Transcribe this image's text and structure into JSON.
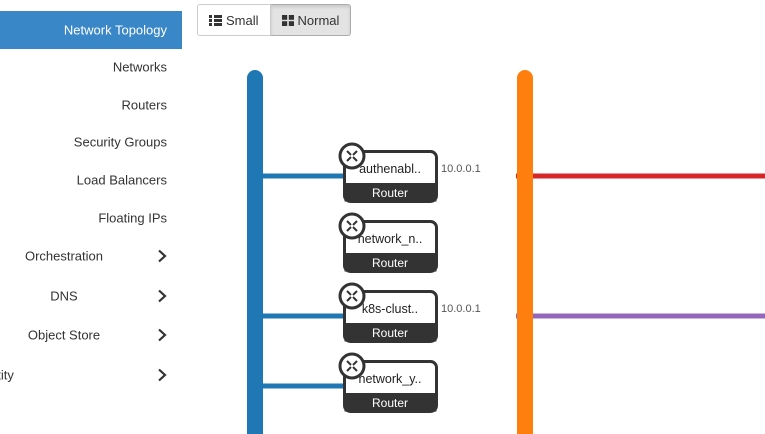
{
  "sidebar": {
    "items": [
      {
        "label": "Network Topology",
        "active": true
      },
      {
        "label": "Networks"
      },
      {
        "label": "Routers"
      },
      {
        "label": "Security Groups"
      },
      {
        "label": "Load Balancers"
      },
      {
        "label": "Floating IPs"
      }
    ],
    "groups": [
      {
        "label": "Orchestration",
        "icon": "chevron-right-icon"
      },
      {
        "label": "DNS",
        "icon": "chevron-right-icon"
      },
      {
        "label": "Object Store",
        "icon": "chevron-right-icon"
      },
      {
        "label": "ntity",
        "icon": "chevron-right-icon"
      }
    ]
  },
  "toolbar": {
    "small_label": "Small",
    "normal_label": "Normal",
    "active": "Normal"
  },
  "topology": {
    "routers": [
      {
        "name": "authenabl..",
        "type": "Router",
        "cidr": "10.0.0.1"
      },
      {
        "name": "network_n..",
        "type": "Router",
        "cidr": ""
      },
      {
        "name": "k8s-clust..",
        "type": "Router",
        "cidr": "10.0.0.1"
      },
      {
        "name": "network_y..",
        "type": "Router",
        "cidr": ""
      }
    ],
    "colors": {
      "external_network": "#1f77b4",
      "router_network": "#ff7f0e",
      "net_red": "#d62728",
      "net_purple": "#9467bd",
      "active_nav": "#3a87c8"
    }
  }
}
